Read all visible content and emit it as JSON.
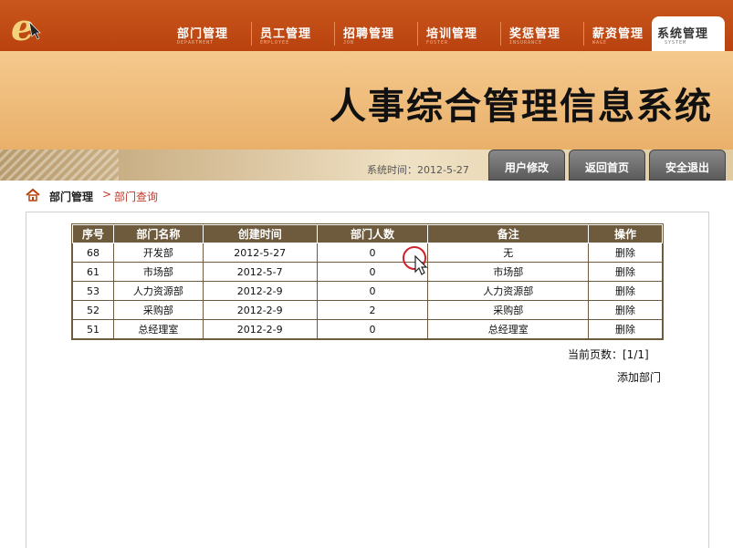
{
  "nav": {
    "items": [
      {
        "label": "部门管理",
        "sub": "DEPARTMENT"
      },
      {
        "label": "员工管理",
        "sub": "EMPLOYEE"
      },
      {
        "label": "招聘管理",
        "sub": "JOB"
      },
      {
        "label": "培训管理",
        "sub": "FOSTER"
      },
      {
        "label": "奖惩管理",
        "sub": "INSURANCE"
      },
      {
        "label": "薪资管理",
        "sub": "WAGE"
      },
      {
        "label": "系统管理",
        "sub": "SYSTEM"
      }
    ],
    "active_index": 6
  },
  "banner": {
    "title": "人事综合管理信息系统"
  },
  "subbar": {
    "systime_label": "系统时间：",
    "systime_value": "2012-5-27",
    "buttons": [
      "用户修改",
      "返回首页",
      "安全退出"
    ]
  },
  "breadcrumb": {
    "parent": "部门管理",
    "separator": ">",
    "current": "部门查询"
  },
  "table": {
    "headers": [
      "序号",
      "部门名称",
      "创建时间",
      "部门人数",
      "备注",
      "操作"
    ],
    "rows": [
      [
        "68",
        "开发部",
        "2012-5-27",
        "0",
        "无",
        "删除"
      ],
      [
        "61",
        "市场部",
        "2012-5-7",
        "0",
        "市场部",
        "删除"
      ],
      [
        "53",
        "人力资源部",
        "2012-2-9",
        "0",
        "人力资源部",
        "删除"
      ],
      [
        "52",
        "采购部",
        "2012-2-9",
        "2",
        "采购部",
        "删除"
      ],
      [
        "51",
        "总经理室",
        "2012-2-9",
        "0",
        "总经理室",
        "删除"
      ]
    ]
  },
  "pagination": {
    "text": "当前页数：[1/1]"
  },
  "actions": {
    "add_label": "添加部门"
  },
  "colors": {
    "nav": "#b9420f",
    "banner": "#f5c98d",
    "table_header": "#6e5a3c",
    "crumb_active": "#c0392b"
  }
}
